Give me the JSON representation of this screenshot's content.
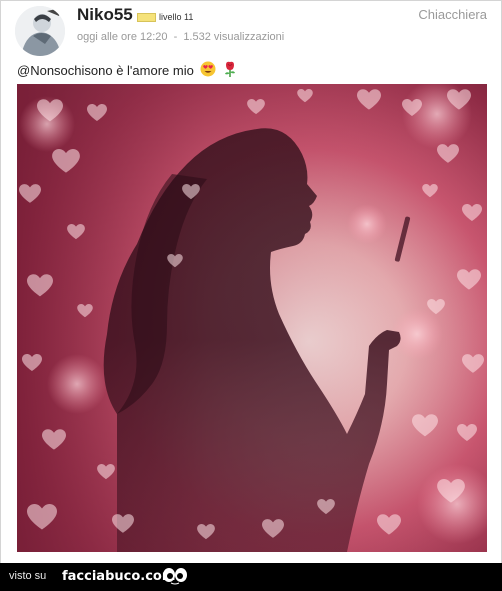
{
  "post": {
    "username": "Niko55",
    "level": "livello 11",
    "category": "Chiacchiera",
    "time": "oggi alle ore 12:20",
    "separator": "-",
    "views": "1.532 visualizzazioni",
    "caption": "@Nonsochisono è l'amore mio",
    "caption_emojis": [
      "heart-eyes-emoji",
      "rose-emoji"
    ]
  },
  "photo": {
    "description_icon": "woman-silhouette-smoking-hearts-bokeh-image"
  },
  "footer": {
    "visto": "visto su",
    "brand": "facciabuco.com"
  }
}
